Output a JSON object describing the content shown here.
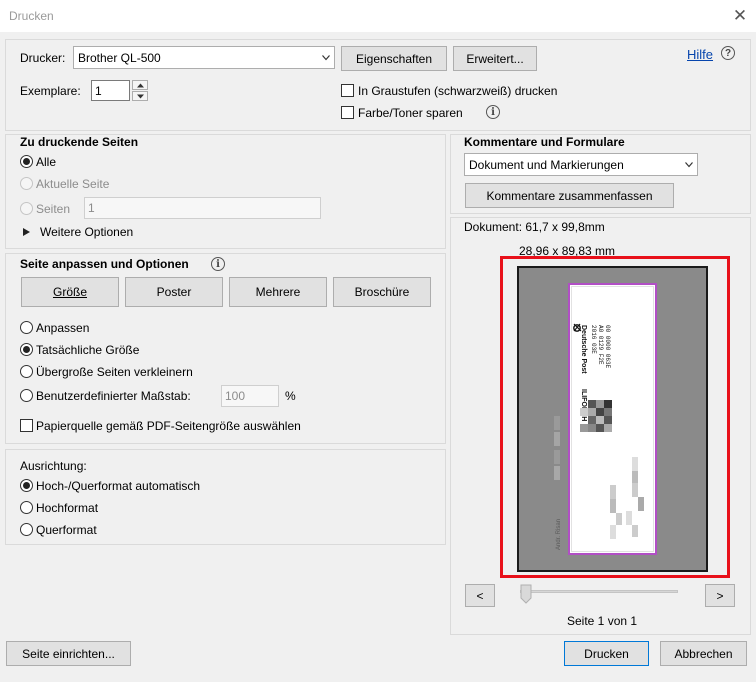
{
  "window": {
    "title": "Drucken",
    "close_glyph": "✕"
  },
  "printer": {
    "label": "Drucker:",
    "selected": "Brother QL-500",
    "properties_button": "Eigenschaften",
    "advanced_button": "Erweitert...",
    "help_link": "Hilfe",
    "help_glyph": "?",
    "copies_label": "Exemplare:",
    "copies_value": "1",
    "grayscale_label": "In Graustufen (schwarzweiß) drucken",
    "grayscale_checked": false,
    "save_toner_label": "Farbe/Toner sparen",
    "save_toner_checked": false
  },
  "pages": {
    "heading": "Zu druckende Seiten",
    "all_label": "Alle",
    "current_label": "Aktuelle Seite",
    "pages_label": "Seiten",
    "pages_value": "1",
    "more_options_label": "Weitere Optionen"
  },
  "sizing": {
    "heading": "Seite anpassen und Optionen",
    "buttons": [
      "Größe",
      "Poster",
      "Mehrere",
      "Broschüre"
    ],
    "fit_label": "Anpassen",
    "actual_label": "Tatsächliche Größe",
    "shrink_label": "Übergroße Seiten verkleinern",
    "custom_label": "Benutzerdefinierter Maßstab:",
    "custom_value": "100",
    "percent": "%",
    "paper_source_label": "Papierquelle gemäß PDF-Seitengröße auswählen"
  },
  "orientation": {
    "heading": "Ausrichtung:",
    "auto_label": "Hoch-/Querformat automatisch",
    "portrait_label": "Hochformat",
    "landscape_label": "Querformat"
  },
  "comments": {
    "heading": "Kommentare und Formulare",
    "selected": "Dokument und Markierungen",
    "summarize_button": "Kommentare zusammenfassen"
  },
  "preview": {
    "document_label": "Dokument: 61,7 x 99,8mm",
    "size_label": "28,96 x 89,83 mm",
    "label_brand": "Deutsche Post",
    "label_codes": [
      "2016  03E",
      "A0 0129 F2E",
      "00 0000 063E"
    ],
    "label_barcode": "ILIFOEYH",
    "label_sender": "Andr. Risan",
    "prev_glyph": "<",
    "next_glyph": ">",
    "page_status": "Seite 1 von 1"
  },
  "footer": {
    "page_setup_button": "Seite einrichten...",
    "print_button": "Drucken",
    "cancel_button": "Abbrechen"
  },
  "colors": {
    "highlight_frame": "#e8101a",
    "preview_gray": "#8a8a8a",
    "page_border": "#b14fc5"
  }
}
